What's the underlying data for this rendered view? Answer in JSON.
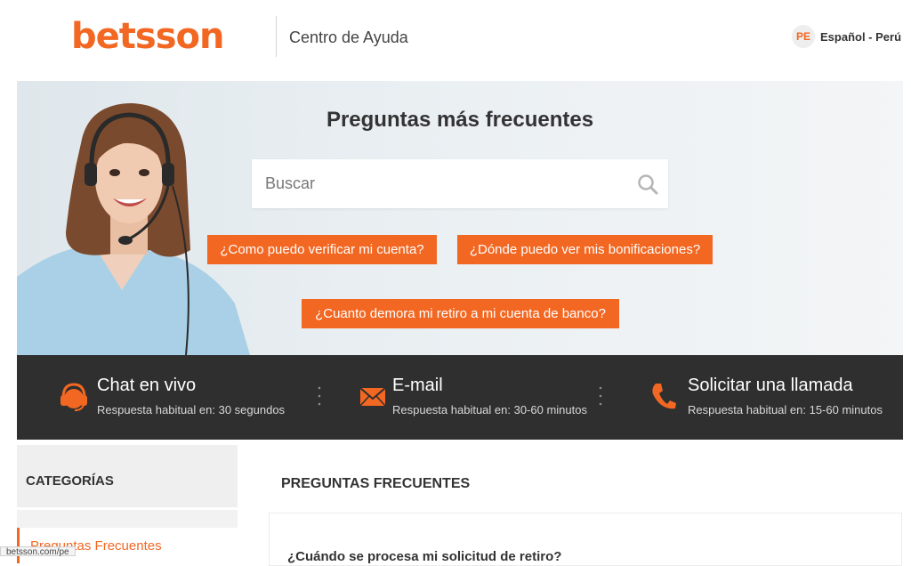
{
  "header": {
    "logo_text": "betsson",
    "help_center": "Centro de Ayuda",
    "language": {
      "code": "PE",
      "label": "Español - Perú"
    }
  },
  "hero": {
    "title": "Preguntas más frecuentes",
    "search": {
      "placeholder": "Buscar",
      "value": ""
    },
    "quick_links": [
      "¿Como puedo verificar mi cuenta?",
      "¿Dónde puedo ver mis bonificaciones?",
      "¿Cuanto demora mi retiro a mi cuenta de banco?"
    ]
  },
  "contact": [
    {
      "title": "Chat en vivo",
      "subtitle": "Respuesta habitual en: 30 segundos",
      "icon": "headset-icon"
    },
    {
      "title": "E-mail",
      "subtitle": "Respuesta habitual en: 30-60 minutos",
      "icon": "envelope-icon"
    },
    {
      "title": "Solicitar una llamada",
      "subtitle": "Respuesta habitual en: 15-60 minutos",
      "icon": "phone-icon"
    }
  ],
  "sidebar": {
    "heading": "CATEGORÍAS",
    "items": [
      "Preguntas Frecuentes"
    ]
  },
  "main": {
    "title": "PREGUNTAS FRECUENTES",
    "first_question": "¿Cuándo se procesa mi solicitud de retiro?"
  },
  "status_bar": {
    "url": "betsson.com/pe"
  },
  "colors": {
    "brand": "#f26722",
    "contact_bar": "#2f2f2f",
    "hero_bg": "#e6ecf0"
  }
}
